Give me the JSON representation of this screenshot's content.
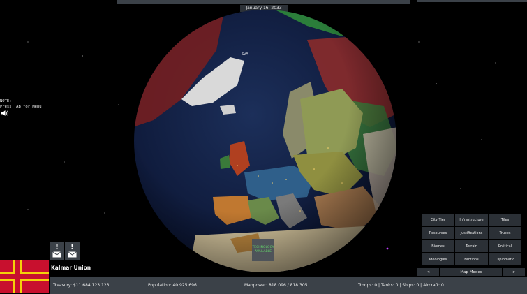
{
  "header": {
    "date": "January 16, 2033"
  },
  "note": {
    "line1": "NOTE:",
    "line2": "Press TAB for Menu!"
  },
  "map": {
    "greenland_label": "SVA",
    "technology_line1": "TECHNOLOGY",
    "technology_line2": "AVAILABLE"
  },
  "player": {
    "country": "Kalmar Union"
  },
  "status": {
    "treasury": "Treasury:   $11 684 123 123",
    "population": "Population: 40 925 696",
    "manpower": "Manpower:  818 096  /  818 305",
    "military": "Troops: 0  |  Tanks: 0  |  Ships: 0  |  Aircraft: 0"
  },
  "map_modes": {
    "buttons": [
      "City Tier",
      "Infrastructure",
      "Tiles",
      "Resources",
      "Justifications",
      "Truces",
      "Biomes",
      "Terrain",
      "Political",
      "Ideologies",
      "Factions",
      "Diplomatic"
    ],
    "prev": "<",
    "label": "Map Modes",
    "next": ">"
  },
  "colors": {
    "panel": "#3b4148",
    "button": "#2b3036",
    "tech_text": "#64d26a",
    "flag_red": "#c8102e",
    "flag_yellow": "#f4d10a"
  }
}
